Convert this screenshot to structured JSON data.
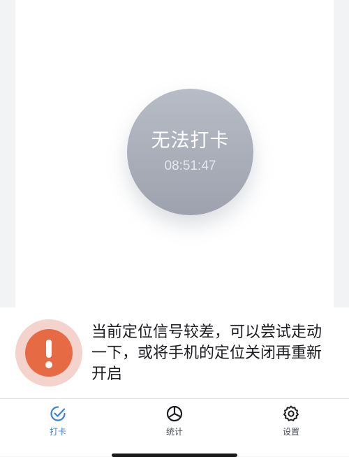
{
  "clock": {
    "status_label": "无法打卡",
    "time": "08:51:47"
  },
  "notice": {
    "message": "当前定位信号较差，可以尝试走动一下，或将手机的定位关闭再重新开启",
    "icon": "exclamation-icon",
    "accent_color": "#e66a44"
  },
  "tabbar": {
    "active": "打卡",
    "accent_color": "#3a7fe0",
    "items": [
      {
        "label": "打卡",
        "icon": "check-icon"
      },
      {
        "label": "统计",
        "icon": "pie-chart-icon"
      },
      {
        "label": "设置",
        "icon": "gear-icon"
      }
    ]
  }
}
